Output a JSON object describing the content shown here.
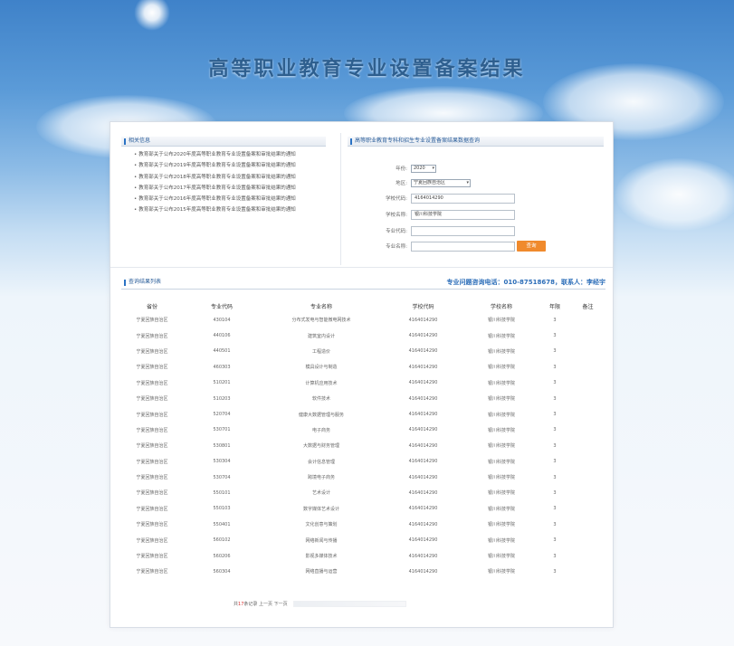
{
  "page_title": "高等职业教育专业设置备案结果",
  "notices": {
    "header": "相关信息",
    "items": [
      "教育部关于公布2020年度高等职业教育专业设置备案和审批结果的通知",
      "教育部关于公布2019年度高等职业教育专业设置备案和审批结果的通知",
      "教育部关于公布2018年度高等职业教育专业设置备案和审批结果的通知",
      "教育部关于公布2017年度高等职业教育专业设置备案和审批结果的通知",
      "教育部关于公布2016年度高等职业教育专业设置备案和审批结果的通知",
      "教育部关于公布2015年度高等职业教育专业设置备案和审批结果的通知"
    ]
  },
  "query_form": {
    "header": "高等职业教育专科和招生专业设置备案结果数据查询",
    "year": {
      "label": "年份:",
      "value": "2020"
    },
    "region": {
      "label": "地区:",
      "value": "宁夏回族自治区"
    },
    "school_code": {
      "label": "学校代码:",
      "value": "4164014290"
    },
    "school_name": {
      "label": "学校名称:",
      "value": "银川科技学院"
    },
    "major_code": {
      "label": "专业代码:",
      "value": ""
    },
    "major_name": {
      "label": "专业名称:",
      "value": ""
    },
    "submit_label": "查询"
  },
  "results": {
    "header": "查询结果列表",
    "contact": "专业问题咨询电话：010-87518678，联系人：李经宇",
    "columns": [
      "省份",
      "专业代码",
      "专业名称",
      "学校代码",
      "学校名称",
      "年限",
      "备注"
    ],
    "rows": [
      [
        "宁夏回族自治区",
        "430104",
        "分布式发电与智能微电网技术",
        "4164014290",
        "银川科技学院",
        "3",
        ""
      ],
      [
        "宁夏回族自治区",
        "440106",
        "建筑室内设计",
        "4164014290",
        "银川科技学院",
        "3",
        ""
      ],
      [
        "宁夏回族自治区",
        "440501",
        "工程造价",
        "4164014290",
        "银川科技学院",
        "3",
        ""
      ],
      [
        "宁夏回族自治区",
        "460303",
        "模具设计与制造",
        "4164014290",
        "银川科技学院",
        "3",
        ""
      ],
      [
        "宁夏回族自治区",
        "510201",
        "计算机应用技术",
        "4164014290",
        "银川科技学院",
        "3",
        ""
      ],
      [
        "宁夏回族自治区",
        "510203",
        "软件技术",
        "4164014290",
        "银川科技学院",
        "3",
        ""
      ],
      [
        "宁夏回族自治区",
        "520704",
        "健康大数据管理与服务",
        "4164014290",
        "银川科技学院",
        "3",
        ""
      ],
      [
        "宁夏回族自治区",
        "530701",
        "电子商务",
        "4164014290",
        "银川科技学院",
        "3",
        ""
      ],
      [
        "宁夏回族自治区",
        "530801",
        "大数据与财务管理",
        "4164014290",
        "银川科技学院",
        "3",
        ""
      ],
      [
        "宁夏回族自治区",
        "530304",
        "会计信息管理",
        "4164014290",
        "银川科技学院",
        "3",
        ""
      ],
      [
        "宁夏回族自治区",
        "530704",
        "跨境电子商务",
        "4164014290",
        "银川科技学院",
        "3",
        ""
      ],
      [
        "宁夏回族自治区",
        "550101",
        "艺术设计",
        "4164014290",
        "银川科技学院",
        "3",
        ""
      ],
      [
        "宁夏回族自治区",
        "550103",
        "数字媒体艺术设计",
        "4164014290",
        "银川科技学院",
        "3",
        ""
      ],
      [
        "宁夏回族自治区",
        "550401",
        "文化创意与策划",
        "4164014290",
        "银川科技学院",
        "3",
        ""
      ],
      [
        "宁夏回族自治区",
        "560102",
        "网络新闻与传播",
        "4164014290",
        "银川科技学院",
        "3",
        ""
      ],
      [
        "宁夏回族自治区",
        "560206",
        "影视多媒体技术",
        "4164014290",
        "银川科技学院",
        "3",
        ""
      ],
      [
        "宁夏回族自治区",
        "560304",
        "网络直播与运营",
        "4164014290",
        "银川科技学院",
        "3",
        ""
      ]
    ]
  },
  "pagination": {
    "prefix": "共",
    "count": "17",
    "suffix": "条记录 上一页 下一页"
  },
  "colors": {
    "accent": "#2b73c4",
    "button": "#f08a2c",
    "title": "#2e5f8f"
  }
}
